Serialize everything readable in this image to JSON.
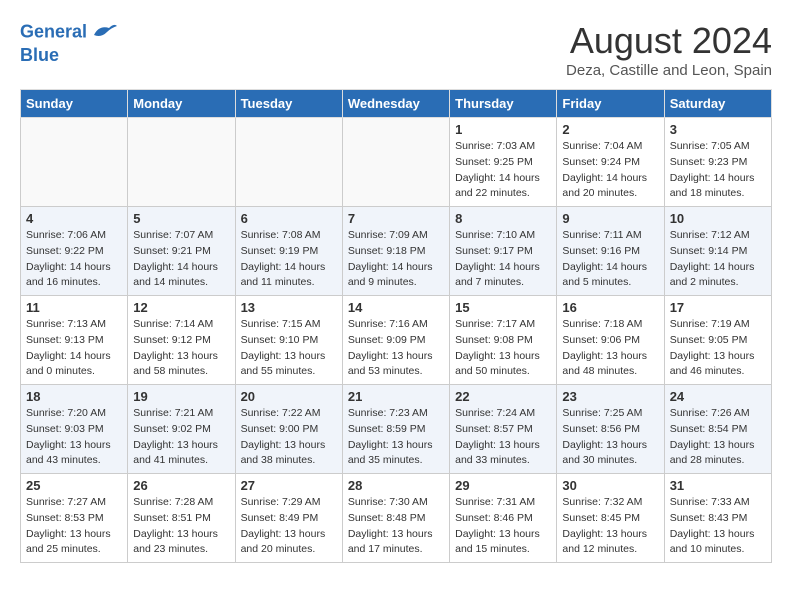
{
  "header": {
    "logo_line1": "General",
    "logo_line2": "Blue",
    "month_title": "August 2024",
    "location": "Deza, Castille and Leon, Spain"
  },
  "weekdays": [
    "Sunday",
    "Monday",
    "Tuesday",
    "Wednesday",
    "Thursday",
    "Friday",
    "Saturday"
  ],
  "weeks": [
    [
      {
        "day": "",
        "sunrise": "",
        "sunset": "",
        "daylight": ""
      },
      {
        "day": "",
        "sunrise": "",
        "sunset": "",
        "daylight": ""
      },
      {
        "day": "",
        "sunrise": "",
        "sunset": "",
        "daylight": ""
      },
      {
        "day": "",
        "sunrise": "",
        "sunset": "",
        "daylight": ""
      },
      {
        "day": "1",
        "sunrise": "Sunrise: 7:03 AM",
        "sunset": "Sunset: 9:25 PM",
        "daylight": "Daylight: 14 hours and 22 minutes."
      },
      {
        "day": "2",
        "sunrise": "Sunrise: 7:04 AM",
        "sunset": "Sunset: 9:24 PM",
        "daylight": "Daylight: 14 hours and 20 minutes."
      },
      {
        "day": "3",
        "sunrise": "Sunrise: 7:05 AM",
        "sunset": "Sunset: 9:23 PM",
        "daylight": "Daylight: 14 hours and 18 minutes."
      }
    ],
    [
      {
        "day": "4",
        "sunrise": "Sunrise: 7:06 AM",
        "sunset": "Sunset: 9:22 PM",
        "daylight": "Daylight: 14 hours and 16 minutes."
      },
      {
        "day": "5",
        "sunrise": "Sunrise: 7:07 AM",
        "sunset": "Sunset: 9:21 PM",
        "daylight": "Daylight: 14 hours and 14 minutes."
      },
      {
        "day": "6",
        "sunrise": "Sunrise: 7:08 AM",
        "sunset": "Sunset: 9:19 PM",
        "daylight": "Daylight: 14 hours and 11 minutes."
      },
      {
        "day": "7",
        "sunrise": "Sunrise: 7:09 AM",
        "sunset": "Sunset: 9:18 PM",
        "daylight": "Daylight: 14 hours and 9 minutes."
      },
      {
        "day": "8",
        "sunrise": "Sunrise: 7:10 AM",
        "sunset": "Sunset: 9:17 PM",
        "daylight": "Daylight: 14 hours and 7 minutes."
      },
      {
        "day": "9",
        "sunrise": "Sunrise: 7:11 AM",
        "sunset": "Sunset: 9:16 PM",
        "daylight": "Daylight: 14 hours and 5 minutes."
      },
      {
        "day": "10",
        "sunrise": "Sunrise: 7:12 AM",
        "sunset": "Sunset: 9:14 PM",
        "daylight": "Daylight: 14 hours and 2 minutes."
      }
    ],
    [
      {
        "day": "11",
        "sunrise": "Sunrise: 7:13 AM",
        "sunset": "Sunset: 9:13 PM",
        "daylight": "Daylight: 14 hours and 0 minutes."
      },
      {
        "day": "12",
        "sunrise": "Sunrise: 7:14 AM",
        "sunset": "Sunset: 9:12 PM",
        "daylight": "Daylight: 13 hours and 58 minutes."
      },
      {
        "day": "13",
        "sunrise": "Sunrise: 7:15 AM",
        "sunset": "Sunset: 9:10 PM",
        "daylight": "Daylight: 13 hours and 55 minutes."
      },
      {
        "day": "14",
        "sunrise": "Sunrise: 7:16 AM",
        "sunset": "Sunset: 9:09 PM",
        "daylight": "Daylight: 13 hours and 53 minutes."
      },
      {
        "day": "15",
        "sunrise": "Sunrise: 7:17 AM",
        "sunset": "Sunset: 9:08 PM",
        "daylight": "Daylight: 13 hours and 50 minutes."
      },
      {
        "day": "16",
        "sunrise": "Sunrise: 7:18 AM",
        "sunset": "Sunset: 9:06 PM",
        "daylight": "Daylight: 13 hours and 48 minutes."
      },
      {
        "day": "17",
        "sunrise": "Sunrise: 7:19 AM",
        "sunset": "Sunset: 9:05 PM",
        "daylight": "Daylight: 13 hours and 46 minutes."
      }
    ],
    [
      {
        "day": "18",
        "sunrise": "Sunrise: 7:20 AM",
        "sunset": "Sunset: 9:03 PM",
        "daylight": "Daylight: 13 hours and 43 minutes."
      },
      {
        "day": "19",
        "sunrise": "Sunrise: 7:21 AM",
        "sunset": "Sunset: 9:02 PM",
        "daylight": "Daylight: 13 hours and 41 minutes."
      },
      {
        "day": "20",
        "sunrise": "Sunrise: 7:22 AM",
        "sunset": "Sunset: 9:00 PM",
        "daylight": "Daylight: 13 hours and 38 minutes."
      },
      {
        "day": "21",
        "sunrise": "Sunrise: 7:23 AM",
        "sunset": "Sunset: 8:59 PM",
        "daylight": "Daylight: 13 hours and 35 minutes."
      },
      {
        "day": "22",
        "sunrise": "Sunrise: 7:24 AM",
        "sunset": "Sunset: 8:57 PM",
        "daylight": "Daylight: 13 hours and 33 minutes."
      },
      {
        "day": "23",
        "sunrise": "Sunrise: 7:25 AM",
        "sunset": "Sunset: 8:56 PM",
        "daylight": "Daylight: 13 hours and 30 minutes."
      },
      {
        "day": "24",
        "sunrise": "Sunrise: 7:26 AM",
        "sunset": "Sunset: 8:54 PM",
        "daylight": "Daylight: 13 hours and 28 minutes."
      }
    ],
    [
      {
        "day": "25",
        "sunrise": "Sunrise: 7:27 AM",
        "sunset": "Sunset: 8:53 PM",
        "daylight": "Daylight: 13 hours and 25 minutes."
      },
      {
        "day": "26",
        "sunrise": "Sunrise: 7:28 AM",
        "sunset": "Sunset: 8:51 PM",
        "daylight": "Daylight: 13 hours and 23 minutes."
      },
      {
        "day": "27",
        "sunrise": "Sunrise: 7:29 AM",
        "sunset": "Sunset: 8:49 PM",
        "daylight": "Daylight: 13 hours and 20 minutes."
      },
      {
        "day": "28",
        "sunrise": "Sunrise: 7:30 AM",
        "sunset": "Sunset: 8:48 PM",
        "daylight": "Daylight: 13 hours and 17 minutes."
      },
      {
        "day": "29",
        "sunrise": "Sunrise: 7:31 AM",
        "sunset": "Sunset: 8:46 PM",
        "daylight": "Daylight: 13 hours and 15 minutes."
      },
      {
        "day": "30",
        "sunrise": "Sunrise: 7:32 AM",
        "sunset": "Sunset: 8:45 PM",
        "daylight": "Daylight: 13 hours and 12 minutes."
      },
      {
        "day": "31",
        "sunrise": "Sunrise: 7:33 AM",
        "sunset": "Sunset: 8:43 PM",
        "daylight": "Daylight: 13 hours and 10 minutes."
      }
    ]
  ]
}
